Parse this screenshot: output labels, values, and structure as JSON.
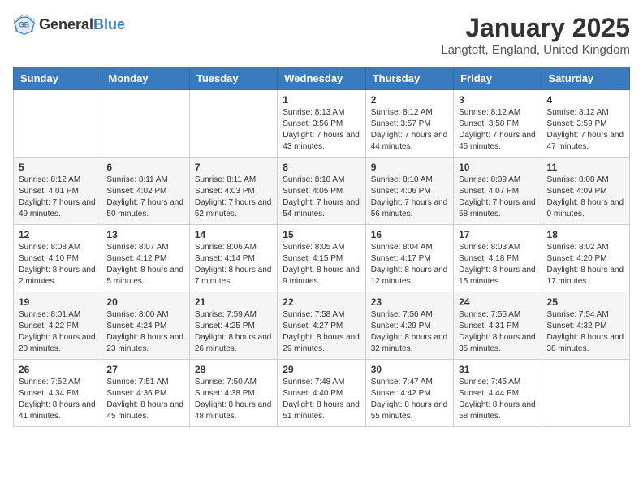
{
  "header": {
    "logo_general": "General",
    "logo_blue": "Blue",
    "month_title": "January 2025",
    "location": "Langtoft, England, United Kingdom"
  },
  "weekdays": [
    "Sunday",
    "Monday",
    "Tuesday",
    "Wednesday",
    "Thursday",
    "Friday",
    "Saturday"
  ],
  "weeks": [
    [
      {
        "day": "",
        "info": ""
      },
      {
        "day": "",
        "info": ""
      },
      {
        "day": "",
        "info": ""
      },
      {
        "day": "1",
        "info": "Sunrise: 8:13 AM\nSunset: 3:56 PM\nDaylight: 7 hours and 43 minutes."
      },
      {
        "day": "2",
        "info": "Sunrise: 8:12 AM\nSunset: 3:57 PM\nDaylight: 7 hours and 44 minutes."
      },
      {
        "day": "3",
        "info": "Sunrise: 8:12 AM\nSunset: 3:58 PM\nDaylight: 7 hours and 45 minutes."
      },
      {
        "day": "4",
        "info": "Sunrise: 8:12 AM\nSunset: 3:59 PM\nDaylight: 7 hours and 47 minutes."
      }
    ],
    [
      {
        "day": "5",
        "info": "Sunrise: 8:12 AM\nSunset: 4:01 PM\nDaylight: 7 hours and 49 minutes."
      },
      {
        "day": "6",
        "info": "Sunrise: 8:11 AM\nSunset: 4:02 PM\nDaylight: 7 hours and 50 minutes."
      },
      {
        "day": "7",
        "info": "Sunrise: 8:11 AM\nSunset: 4:03 PM\nDaylight: 7 hours and 52 minutes."
      },
      {
        "day": "8",
        "info": "Sunrise: 8:10 AM\nSunset: 4:05 PM\nDaylight: 7 hours and 54 minutes."
      },
      {
        "day": "9",
        "info": "Sunrise: 8:10 AM\nSunset: 4:06 PM\nDaylight: 7 hours and 56 minutes."
      },
      {
        "day": "10",
        "info": "Sunrise: 8:09 AM\nSunset: 4:07 PM\nDaylight: 7 hours and 58 minutes."
      },
      {
        "day": "11",
        "info": "Sunrise: 8:08 AM\nSunset: 4:09 PM\nDaylight: 8 hours and 0 minutes."
      }
    ],
    [
      {
        "day": "12",
        "info": "Sunrise: 8:08 AM\nSunset: 4:10 PM\nDaylight: 8 hours and 2 minutes."
      },
      {
        "day": "13",
        "info": "Sunrise: 8:07 AM\nSunset: 4:12 PM\nDaylight: 8 hours and 5 minutes."
      },
      {
        "day": "14",
        "info": "Sunrise: 8:06 AM\nSunset: 4:14 PM\nDaylight: 8 hours and 7 minutes."
      },
      {
        "day": "15",
        "info": "Sunrise: 8:05 AM\nSunset: 4:15 PM\nDaylight: 8 hours and 9 minutes."
      },
      {
        "day": "16",
        "info": "Sunrise: 8:04 AM\nSunset: 4:17 PM\nDaylight: 8 hours and 12 minutes."
      },
      {
        "day": "17",
        "info": "Sunrise: 8:03 AM\nSunset: 4:18 PM\nDaylight: 8 hours and 15 minutes."
      },
      {
        "day": "18",
        "info": "Sunrise: 8:02 AM\nSunset: 4:20 PM\nDaylight: 8 hours and 17 minutes."
      }
    ],
    [
      {
        "day": "19",
        "info": "Sunrise: 8:01 AM\nSunset: 4:22 PM\nDaylight: 8 hours and 20 minutes."
      },
      {
        "day": "20",
        "info": "Sunrise: 8:00 AM\nSunset: 4:24 PM\nDaylight: 8 hours and 23 minutes."
      },
      {
        "day": "21",
        "info": "Sunrise: 7:59 AM\nSunset: 4:25 PM\nDaylight: 8 hours and 26 minutes."
      },
      {
        "day": "22",
        "info": "Sunrise: 7:58 AM\nSunset: 4:27 PM\nDaylight: 8 hours and 29 minutes."
      },
      {
        "day": "23",
        "info": "Sunrise: 7:56 AM\nSunset: 4:29 PM\nDaylight: 8 hours and 32 minutes."
      },
      {
        "day": "24",
        "info": "Sunrise: 7:55 AM\nSunset: 4:31 PM\nDaylight: 8 hours and 35 minutes."
      },
      {
        "day": "25",
        "info": "Sunrise: 7:54 AM\nSunset: 4:32 PM\nDaylight: 8 hours and 38 minutes."
      }
    ],
    [
      {
        "day": "26",
        "info": "Sunrise: 7:52 AM\nSunset: 4:34 PM\nDaylight: 8 hours and 41 minutes."
      },
      {
        "day": "27",
        "info": "Sunrise: 7:51 AM\nSunset: 4:36 PM\nDaylight: 8 hours and 45 minutes."
      },
      {
        "day": "28",
        "info": "Sunrise: 7:50 AM\nSunset: 4:38 PM\nDaylight: 8 hours and 48 minutes."
      },
      {
        "day": "29",
        "info": "Sunrise: 7:48 AM\nSunset: 4:40 PM\nDaylight: 8 hours and 51 minutes."
      },
      {
        "day": "30",
        "info": "Sunrise: 7:47 AM\nSunset: 4:42 PM\nDaylight: 8 hours and 55 minutes."
      },
      {
        "day": "31",
        "info": "Sunrise: 7:45 AM\nSunset: 4:44 PM\nDaylight: 8 hours and 58 minutes."
      },
      {
        "day": "",
        "info": ""
      }
    ]
  ]
}
